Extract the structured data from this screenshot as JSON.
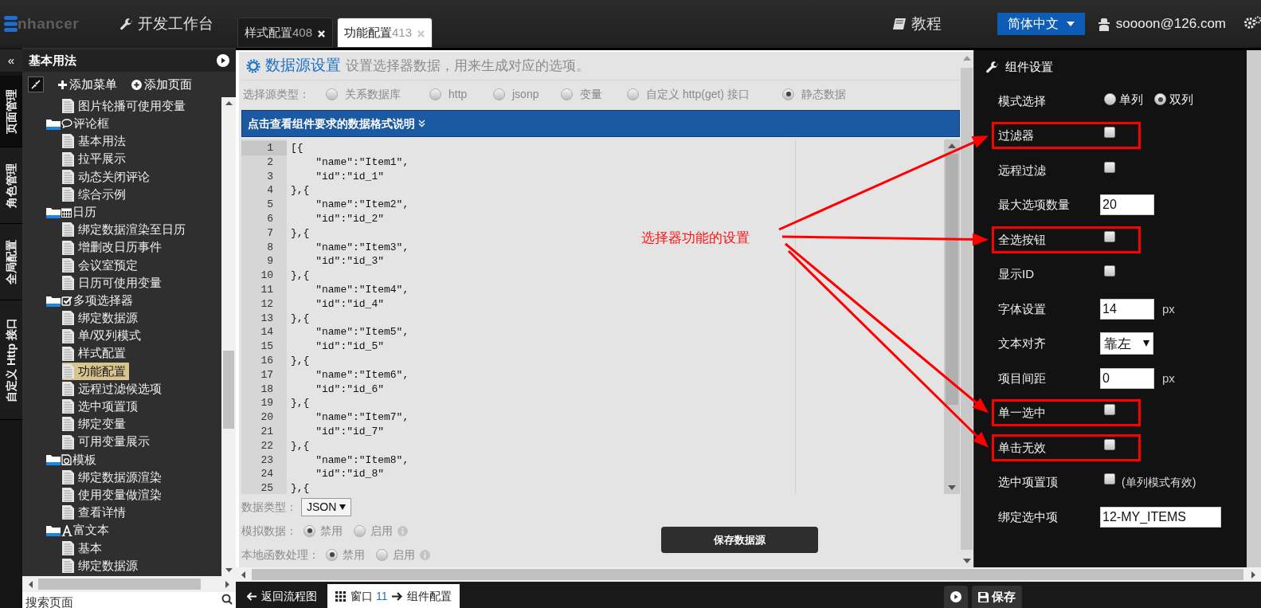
{
  "topbar": {
    "logo_text": "nhancer",
    "workbench": "开发工作台",
    "tabs": [
      {
        "label": "样式配置",
        "count": "408",
        "selected": false
      },
      {
        "label": "功能配置",
        "count": "413",
        "selected": true
      }
    ],
    "tutorial": "教程",
    "language": "简体中文",
    "user": "soooon@126.com"
  },
  "collapse": "«",
  "side_tabs": [
    {
      "label": "页面管理",
      "selected": true
    },
    {
      "label": "角色管理",
      "selected": false
    },
    {
      "label": "全局配置",
      "selected": false
    },
    {
      "label": "自定义 Http 接口",
      "selected": false
    }
  ],
  "sidebar": {
    "title": "基本用法",
    "actions": [
      "添加菜单",
      "添加页面"
    ],
    "tree": [
      {
        "kind": "page",
        "label": "图片轮播可使用变量",
        "selected": false
      },
      {
        "kind": "comment",
        "label": "评论框",
        "selected": false,
        "children": [
          {
            "kind": "page",
            "label": "基本用法",
            "selected": false
          },
          {
            "kind": "page",
            "label": "拉平展示",
            "selected": false
          },
          {
            "kind": "page",
            "label": "动态关闭评论",
            "selected": false
          },
          {
            "kind": "page",
            "label": "综合示例",
            "selected": false
          }
        ]
      },
      {
        "kind": "calendar",
        "label": "日历",
        "selected": false,
        "children": [
          {
            "kind": "page",
            "label": "绑定数据渲染至日历",
            "selected": false
          },
          {
            "kind": "page",
            "label": "增删改日历事件",
            "selected": false
          },
          {
            "kind": "page",
            "label": "会议室预定",
            "selected": false
          },
          {
            "kind": "page",
            "label": "日历可使用变量",
            "selected": false
          }
        ]
      },
      {
        "kind": "checklist",
        "label": "多项选择器",
        "selected": false,
        "children": [
          {
            "kind": "page",
            "label": "绑定数据源",
            "selected": false
          },
          {
            "kind": "page",
            "label": "单/双列模式",
            "selected": false
          },
          {
            "kind": "page",
            "label": "样式配置",
            "selected": false
          },
          {
            "kind": "page",
            "label": "功能配置",
            "selected": true
          },
          {
            "kind": "page",
            "label": "远程过滤候选项",
            "selected": false
          },
          {
            "kind": "page",
            "label": "选中项置顶",
            "selected": false
          },
          {
            "kind": "page",
            "label": "绑定变量",
            "selected": false
          },
          {
            "kind": "page",
            "label": "可用变量展示",
            "selected": false
          }
        ]
      },
      {
        "kind": "template",
        "label": "模板",
        "selected": false,
        "children": [
          {
            "kind": "page",
            "label": "绑定数据源渲染",
            "selected": false
          },
          {
            "kind": "page",
            "label": "使用变量做渲染",
            "selected": false
          },
          {
            "kind": "page",
            "label": "查看详情",
            "selected": false
          }
        ]
      },
      {
        "kind": "richtext",
        "label": "富文本",
        "selected": false,
        "children": [
          {
            "kind": "page",
            "label": "基本",
            "selected": false
          },
          {
            "kind": "page",
            "label": "绑定数据源",
            "selected": false
          }
        ]
      }
    ],
    "search": {
      "placeholder": "搜索页面"
    }
  },
  "center": {
    "title": "数据源设置",
    "subtitle": "设置选择器数据，用来生成对应的选项。",
    "source": {
      "label": "选择源类型：",
      "options": [
        {
          "label": "关系数据库",
          "selected": false
        },
        {
          "label": "http",
          "selected": false
        },
        {
          "label": "jsonp",
          "selected": false
        },
        {
          "label": "变量",
          "selected": false
        },
        {
          "label": "自定义 http(get) 接口",
          "selected": false
        },
        {
          "label": "静态数据",
          "selected": true
        }
      ]
    },
    "format_bar": "点击查看组件要求的数据格式说明",
    "editor": {
      "lines": [
        {
          "number": "1",
          "text": "[{",
          "active": true
        },
        {
          "number": "2",
          "text": "    \"name\":\"Item1\",",
          "active": false
        },
        {
          "number": "3",
          "text": "    \"id\":\"id_1\"",
          "active": false
        },
        {
          "number": "4",
          "text": "},{",
          "active": false
        },
        {
          "number": "5",
          "text": "    \"name\":\"Item2\",",
          "active": false
        },
        {
          "number": "6",
          "text": "    \"id\":\"id_2\"",
          "active": false
        },
        {
          "number": "7",
          "text": "},{",
          "active": false
        },
        {
          "number": "8",
          "text": "    \"name\":\"Item3\",",
          "active": false
        },
        {
          "number": "9",
          "text": "    \"id\":\"id_3\"",
          "active": false
        },
        {
          "number": "10",
          "text": "},{",
          "active": false
        },
        {
          "number": "11",
          "text": "    \"name\":\"Item4\",",
          "active": false
        },
        {
          "number": "12",
          "text": "    \"id\":\"id_4\"",
          "active": false
        },
        {
          "number": "13",
          "text": "},{",
          "active": false
        },
        {
          "number": "14",
          "text": "    \"name\":\"Item5\",",
          "active": false
        },
        {
          "number": "15",
          "text": "    \"id\":\"id_5\"",
          "active": false
        },
        {
          "number": "16",
          "text": "},{",
          "active": false
        },
        {
          "number": "17",
          "text": "    \"name\":\"Item6\",",
          "active": false
        },
        {
          "number": "18",
          "text": "    \"id\":\"id_6\"",
          "active": false
        },
        {
          "number": "19",
          "text": "},{",
          "active": false
        },
        {
          "number": "20",
          "text": "    \"name\":\"Item7\",",
          "active": false
        },
        {
          "number": "21",
          "text": "    \"id\":\"id_7\"",
          "active": false
        },
        {
          "number": "22",
          "text": "},{",
          "active": false
        },
        {
          "number": "23",
          "text": "    \"name\":\"Item8\",",
          "active": false
        },
        {
          "number": "24",
          "text": "    \"id\":\"id_8\"",
          "active": false
        },
        {
          "number": "25",
          "text": "},{",
          "active": false
        }
      ]
    },
    "data_type": {
      "label": "数据类型：",
      "value": "JSON"
    },
    "mock": {
      "label": "模拟数据：",
      "options": [
        {
          "label": "禁用",
          "selected": true
        },
        {
          "label": "启用",
          "selected": false
        }
      ]
    },
    "local": {
      "label": "本地函数处理：",
      "options": [
        {
          "label": "禁用",
          "selected": true
        },
        {
          "label": "启用",
          "selected": false
        }
      ]
    },
    "save": "保存数据源"
  },
  "settings": {
    "title": "组件设置",
    "rows": [
      {
        "kind": "radio",
        "label": "模式选择",
        "highlighted": false,
        "options": [
          {
            "label": "单列",
            "selected": false
          },
          {
            "label": "双列",
            "selected": true
          }
        ]
      },
      {
        "kind": "checkbox",
        "label": "过滤器",
        "checked": false,
        "highlighted": true
      },
      {
        "kind": "checkbox",
        "label": "远程过滤",
        "checked": false,
        "highlighted": false
      },
      {
        "kind": "input",
        "label": "最大选项数量",
        "value": "20",
        "highlighted": false
      },
      {
        "kind": "checkbox",
        "label": "全选按钮",
        "checked": false,
        "highlighted": true
      },
      {
        "kind": "checkbox",
        "label": "显示ID",
        "checked": false,
        "highlighted": false
      },
      {
        "kind": "input",
        "label": "字体设置",
        "value": "14",
        "unit": "px",
        "highlighted": false
      },
      {
        "kind": "select",
        "label": "文本对齐",
        "value": "靠左",
        "highlighted": false
      },
      {
        "kind": "input",
        "label": "项目间距",
        "value": "0",
        "unit": "px",
        "highlighted": false
      },
      {
        "kind": "checkbox",
        "label": "单一选中",
        "checked": false,
        "highlighted": true
      },
      {
        "kind": "checkbox",
        "label": "单击无效",
        "checked": false,
        "highlighted": true
      },
      {
        "kind": "checkbox",
        "label": "选中项置顶",
        "checked": false,
        "note": "(单列模式有效)",
        "highlighted": false
      },
      {
        "kind": "textfield",
        "label": "绑定选中项",
        "value": "12-MY_ITEMS",
        "highlighted": false
      }
    ]
  },
  "annotation": {
    "text": "选择器功能的设置"
  },
  "bottom": {
    "back": "返回流程图",
    "tab": {
      "label": "窗口",
      "number": "11",
      "target": "组件配置"
    },
    "save": "保存"
  }
}
